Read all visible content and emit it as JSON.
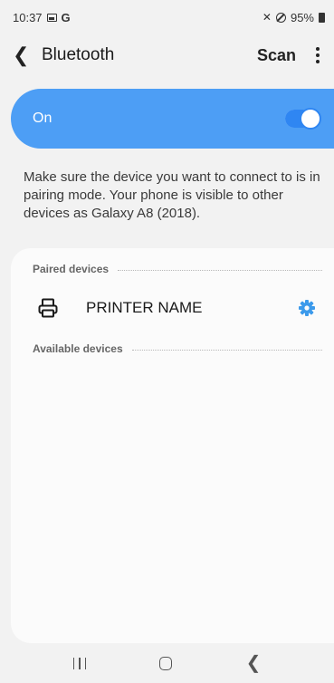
{
  "status_bar": {
    "time": "10:37",
    "g_label": "G",
    "battery": "95%",
    "icons": [
      "image-icon",
      "mute-icon",
      "block-icon",
      "battery-icon"
    ]
  },
  "header": {
    "back_icon": "back-arrow-icon",
    "title": "Bluetooth",
    "scan_label": "Scan",
    "more_icon": "more-vertical-icon"
  },
  "bluetooth_toggle": {
    "label": "On",
    "enabled": true,
    "accent": "#4d9ef5"
  },
  "description": "Make sure the device you want to connect to is in pairing mode. Your phone is visible to other devices as Galaxy A8 (2018).",
  "paired": {
    "header": "Paired devices",
    "devices": [
      {
        "name": "PRINTER NAME",
        "icon": "printer-icon",
        "settings_icon": "gear-icon"
      }
    ]
  },
  "available": {
    "header": "Available devices"
  },
  "nav_bar": {
    "icons": [
      "recents-icon",
      "home-icon",
      "back-icon"
    ]
  }
}
